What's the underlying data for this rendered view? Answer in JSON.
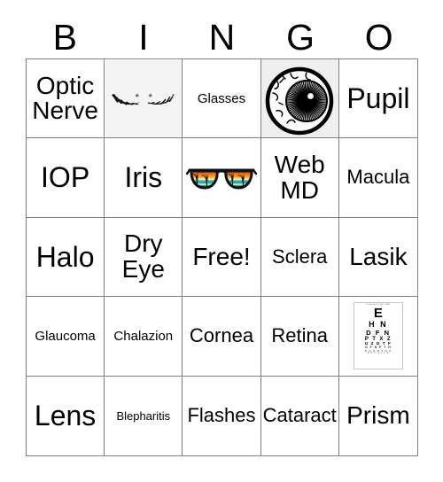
{
  "card": {
    "title_letters": [
      "B",
      "I",
      "N",
      "G",
      "O"
    ],
    "colors": {
      "grid_line": "#808080",
      "text": "#000000",
      "shaded_cell_bg": "#efefef",
      "lash_cell_bg": "#f4f4f4",
      "page_bg": "#ffffff"
    },
    "cells": [
      {
        "label": "Optic Nerve",
        "type": "text",
        "size": "lg",
        "shaded": false
      },
      {
        "label": "",
        "type": "image",
        "icon": "eyelashes-icon",
        "shaded": false
      },
      {
        "label": "Glasses",
        "type": "text",
        "size": "sm",
        "shaded": false
      },
      {
        "label": "",
        "type": "image",
        "icon": "eyeball-icon",
        "shaded": true
      },
      {
        "label": "Pupil",
        "type": "text",
        "size": "xl",
        "shaded": false
      },
      {
        "label": "IOP",
        "type": "text",
        "size": "xl",
        "shaded": false
      },
      {
        "label": "Iris",
        "type": "text",
        "size": "xl",
        "shaded": false
      },
      {
        "label": "",
        "type": "image",
        "icon": "sunglasses-icon",
        "shaded": false
      },
      {
        "label": "Web MD",
        "type": "text",
        "size": "lg",
        "shaded": false
      },
      {
        "label": "Macula",
        "type": "text",
        "size": "md",
        "shaded": false
      },
      {
        "label": "Halo",
        "type": "text",
        "size": "xl",
        "shaded": false
      },
      {
        "label": "Dry Eye",
        "type": "text",
        "size": "lg",
        "shaded": false
      },
      {
        "label": "Free!",
        "type": "text",
        "size": "lg",
        "shaded": false
      },
      {
        "label": "Sclera",
        "type": "text",
        "size": "md",
        "shaded": false
      },
      {
        "label": "Lasik",
        "type": "text",
        "size": "lg",
        "shaded": false
      },
      {
        "label": "Glaucoma",
        "type": "text",
        "size": "sm",
        "shaded": false
      },
      {
        "label": "Chalazion",
        "type": "text",
        "size": "sm",
        "shaded": false
      },
      {
        "label": "Cornea",
        "type": "text",
        "size": "md",
        "shaded": false
      },
      {
        "label": "Retina",
        "type": "text",
        "size": "md",
        "shaded": false
      },
      {
        "label": "",
        "type": "image",
        "icon": "eye-chart-icon",
        "shaded": false
      },
      {
        "label": "Lens",
        "type": "text",
        "size": "xl",
        "shaded": false
      },
      {
        "label": "Blepharitis",
        "type": "text",
        "size": "xs",
        "shaded": false
      },
      {
        "label": "Flashes",
        "type": "text",
        "size": "md",
        "shaded": false
      },
      {
        "label": "Cataract",
        "type": "text",
        "size": "md",
        "shaded": false
      },
      {
        "label": "Prism",
        "type": "text",
        "size": "lg",
        "shaded": false
      }
    ]
  },
  "eye_chart": {
    "header": "VISUAL ACUITY TEST CHART",
    "rows": [
      "E",
      "H N",
      "D F N",
      "P T X Z",
      "U Z D T F",
      "D F N P T H",
      "P H U N T D Z",
      "N D F U Z T E"
    ]
  }
}
